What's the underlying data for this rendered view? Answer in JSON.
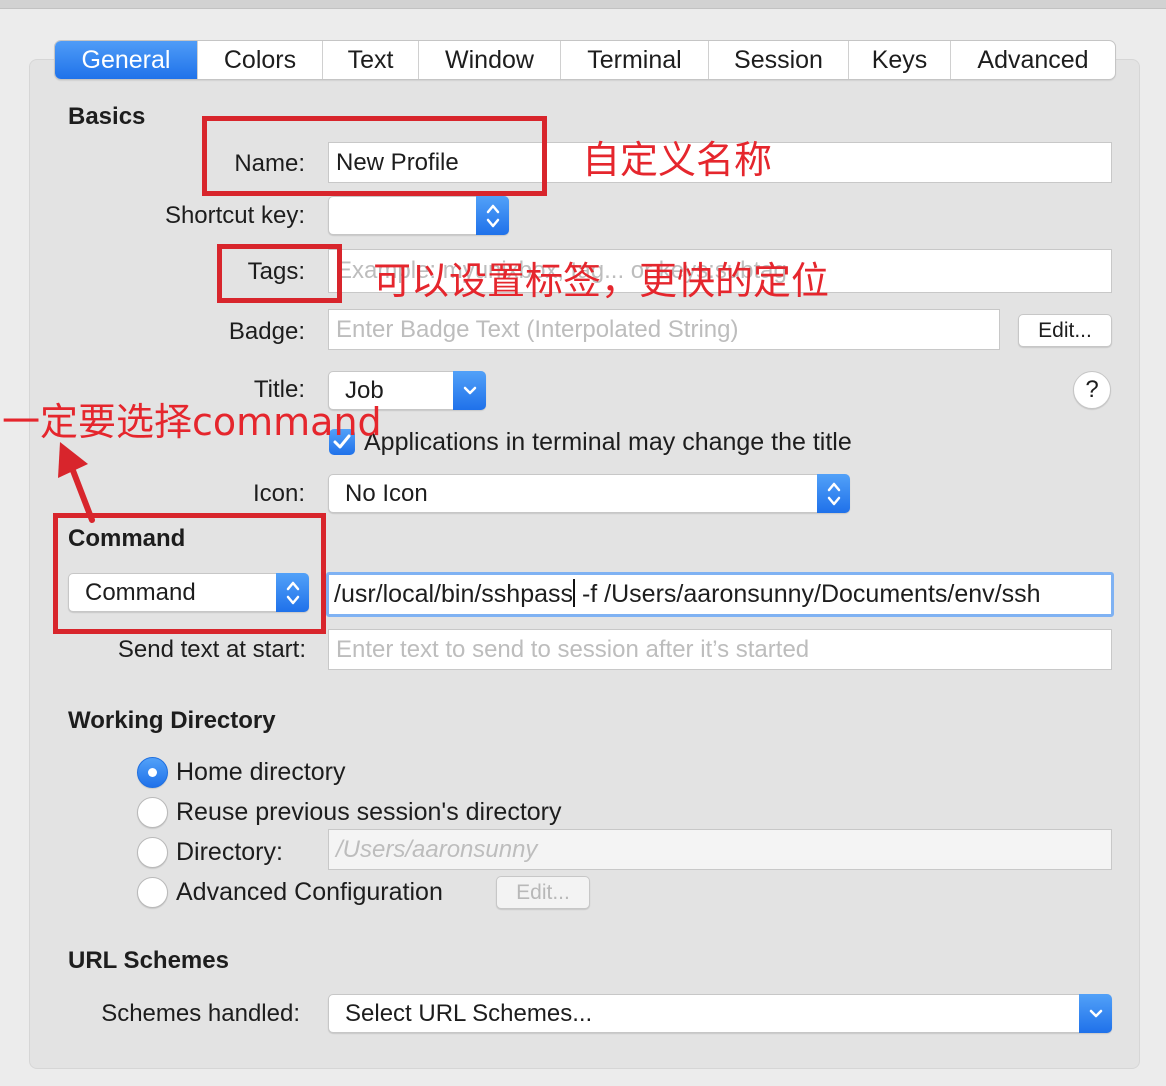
{
  "tabs": [
    {
      "label": "General",
      "active": true
    },
    {
      "label": "Colors"
    },
    {
      "label": "Text"
    },
    {
      "label": "Window"
    },
    {
      "label": "Terminal"
    },
    {
      "label": "Session"
    },
    {
      "label": "Keys"
    },
    {
      "label": "Advanced"
    }
  ],
  "basics": {
    "heading": "Basics",
    "name_label": "Name:",
    "name_value": "New Profile",
    "shortcut_label": "Shortcut key:",
    "tags_label": "Tags:",
    "tags_placeholder": "Example: myunixbox, tag... or keys:subtag",
    "badge_label": "Badge:",
    "badge_placeholder": "Enter Badge Text (Interpolated String)",
    "badge_edit": "Edit...",
    "title_label": "Title:",
    "title_value": "Job",
    "help": "?",
    "checkbox_label": "Applications in terminal may change the title",
    "icon_label": "Icon:",
    "icon_value": "No Icon"
  },
  "command": {
    "heading": "Command",
    "type_value": "Command",
    "value_before_caret": "/usr/local/bin/sshpass",
    "value_after_caret": " -f /Users/aaronsunny/Documents/env/ssh",
    "send_label": "Send text at start:",
    "send_placeholder": "Enter text to send to session after it’s started"
  },
  "working_directory": {
    "heading": "Working Directory",
    "options": [
      "Home directory",
      "Reuse previous session's directory",
      "Directory:",
      "Advanced Configuration"
    ],
    "selected": 0,
    "directory_placeholder": "/Users/aaronsunny",
    "edit": "Edit..."
  },
  "url_schemes": {
    "heading": "URL Schemes",
    "label": "Schemes handled:",
    "value": "Select URL Schemes..."
  },
  "annotations": {
    "name_note": "自定义名称",
    "tags_note": "可以设置标签，更快的定位",
    "command_note": "一定要选择command",
    "color": "#d8252c"
  },
  "colors": {
    "accent": "#1f72ea",
    "panel": "#e3e3e3",
    "background": "#ececec",
    "focus_ring": "#7fb2f3"
  },
  "icons": [
    "stepper-icon",
    "chevron-down-icon",
    "checkmark-icon",
    "arrow-up-icon"
  ]
}
